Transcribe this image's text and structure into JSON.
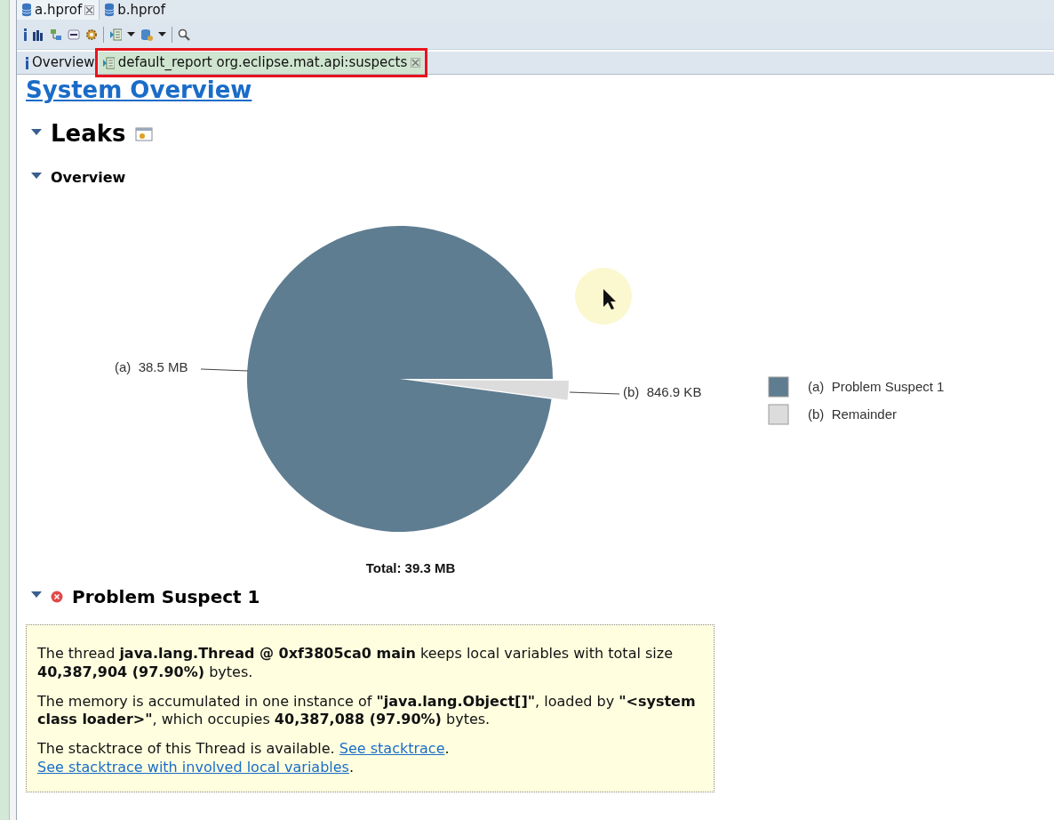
{
  "editor_tabs": [
    {
      "label": "a.hprof",
      "selected": true,
      "closable": true
    },
    {
      "label": "b.hprof",
      "selected": false,
      "closable": false
    }
  ],
  "toolbar": {
    "items": [
      {
        "kind": "info"
      },
      {
        "kind": "histogram"
      },
      {
        "kind": "tree"
      },
      {
        "kind": "oql"
      },
      {
        "kind": "gear"
      },
      {
        "kind": "sep"
      },
      {
        "kind": "report",
        "dropdown": true
      },
      {
        "kind": "db",
        "dropdown": true
      },
      {
        "kind": "sep"
      },
      {
        "kind": "search"
      }
    ]
  },
  "report_tabs": [
    {
      "label": "Overview",
      "selected": false,
      "highlighted": false,
      "closable": false,
      "kind": "info"
    },
    {
      "label": "default_report  org.eclipse.mat.api:suspects",
      "selected": true,
      "highlighted": true,
      "closable": true,
      "kind": "report"
    }
  ],
  "page_title": "System Overview",
  "sections": [
    {
      "title": "Leaks",
      "kind": "heading",
      "expanded": true
    },
    {
      "title": "Overview",
      "kind": "subheading",
      "expanded": true
    }
  ],
  "chart": {
    "chart_data": {
      "type": "pie",
      "title": "Total: 39.3 MB",
      "categories": [
        "(a)",
        "(b)"
      ],
      "series": [
        {
          "values": [
            97.9,
            2.1
          ]
        }
      ],
      "colors": [
        "#5f7d91",
        "#dcdcdc"
      ],
      "value_labels": [
        "38.5 MB",
        "846.9 KB"
      ]
    },
    "legend": [
      {
        "label": "(a)",
        "name": "Problem Suspect 1",
        "color": "#5f7d91"
      },
      {
        "label": "(b)",
        "name": "Remainder",
        "color": "#dcdcdc"
      }
    ]
  },
  "suspect": {
    "title": "Problem Suspect 1",
    "expanded": true,
    "paragraphs": [
      [
        {
          "kind": "text",
          "text": "The thread **java.lang.Thread @ 0xf3805ca0 main** keeps local variables with total size **40,387,904 (97.90%)** bytes."
        }
      ],
      [
        {
          "kind": "text",
          "text": "The memory is accumulated in one instance of **\"java.lang.Object[]\"**, loaded by **\"<system class loader>\"**, which occupies **40,387,088 (97.90%)** bytes."
        }
      ],
      [
        {
          "kind": "text",
          "text": "The stacktrace of this Thread is available. "
        },
        {
          "kind": "link",
          "text": "See stacktrace"
        },
        {
          "kind": "text",
          "text": ". "
        },
        {
          "kind": "link",
          "text": "See stacktrace with involved local variables"
        },
        {
          "kind": "text",
          "text": "."
        }
      ]
    ]
  }
}
